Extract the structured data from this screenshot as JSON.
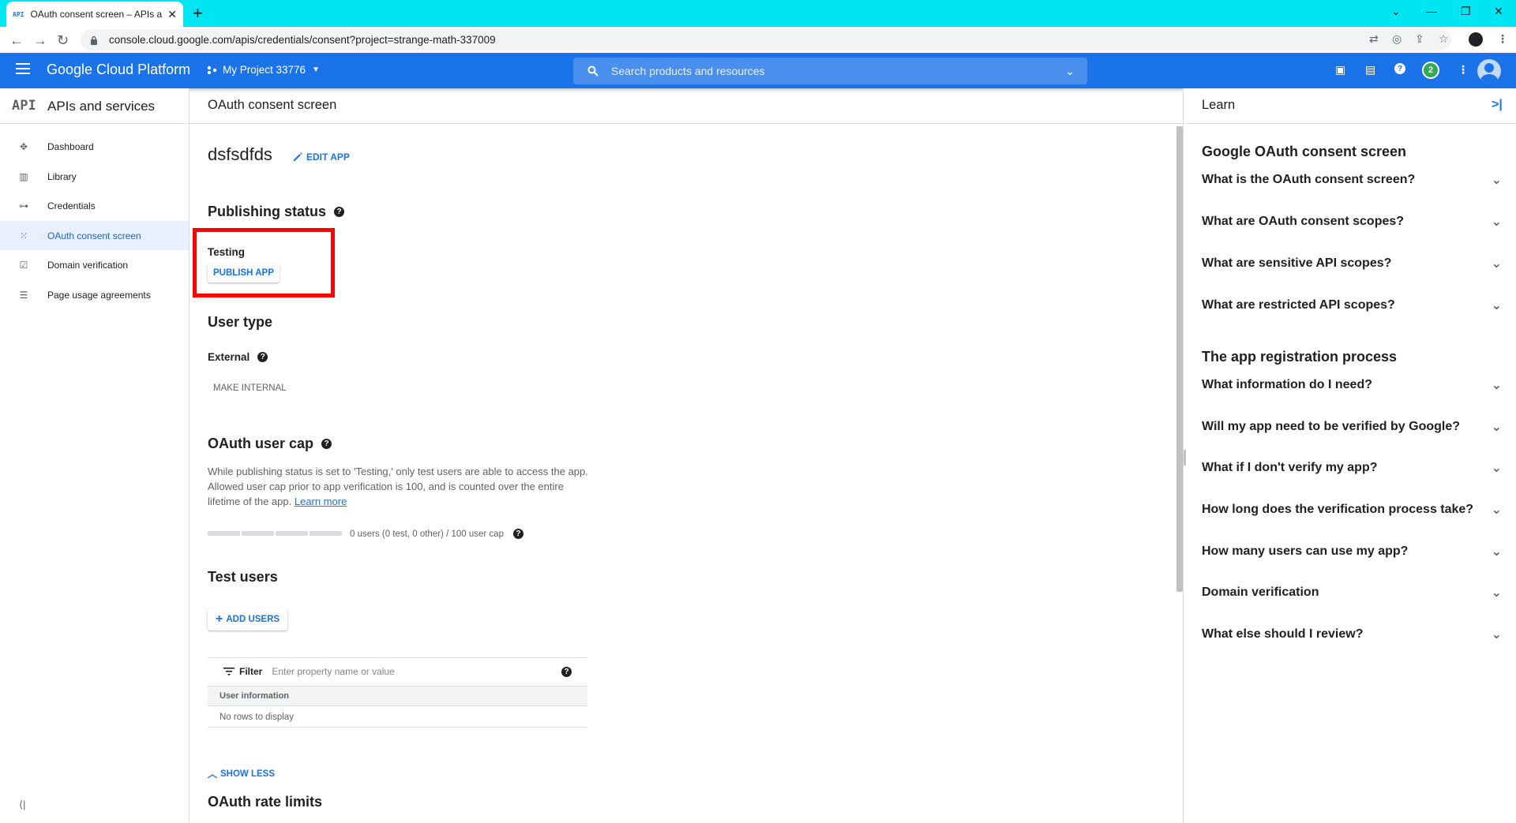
{
  "browser": {
    "tab_title": "OAuth consent screen – APIs and services",
    "tab_favicon": "API",
    "url": "console.cloud.google.com/apis/credentials/consent?project=strange-math-337009"
  },
  "header": {
    "brand": "Google Cloud Platform",
    "project": "My Project 33776",
    "search_placeholder": "Search products and resources",
    "notification_count": "2"
  },
  "sidebar": {
    "logo": "API",
    "title": "APIs and services",
    "items": [
      {
        "label": "Dashboard",
        "icon": "dashboard-icon"
      },
      {
        "label": "Library",
        "icon": "library-icon"
      },
      {
        "label": "Credentials",
        "icon": "key-icon"
      },
      {
        "label": "OAuth consent screen",
        "icon": "consent-icon",
        "active": true
      },
      {
        "label": "Domain verification",
        "icon": "checkbox-icon"
      },
      {
        "label": "Page usage agreements",
        "icon": "settings-list-icon"
      }
    ]
  },
  "main": {
    "page_title": "OAuth consent screen",
    "app_name": "dsfsdfds",
    "edit_app": "EDIT APP",
    "publishing_status": {
      "heading": "Publishing status",
      "status": "Testing",
      "publish_button": "PUBLISH APP"
    },
    "user_type": {
      "heading": "User type",
      "value": "External",
      "make_internal": "MAKE INTERNAL"
    },
    "user_cap": {
      "heading": "OAuth user cap",
      "description": "While publishing status is set to 'Testing,' only test users are able to access the app. Allowed user cap prior to app verification is 100, and is counted over the entire lifetime of the app.",
      "learn_more": "Learn more",
      "cap_text": "0 users (0 test, 0 other) / 100 user cap",
      "cap_fraction": 0
    },
    "test_users": {
      "heading": "Test users",
      "add_users": "ADD USERS",
      "filter_label": "Filter",
      "filter_placeholder": "Enter property name or value",
      "column_header": "User information",
      "empty_text": "No rows to display"
    },
    "show_less": "SHOW LESS",
    "rate_limits_heading": "OAuth rate limits"
  },
  "learn": {
    "title": "Learn",
    "section1": "Google OAuth consent screen",
    "section1_items": [
      "What is the OAuth consent screen?",
      "What are OAuth consent scopes?",
      "What are sensitive API scopes?",
      "What are restricted API scopes?"
    ],
    "section2": "The app registration process",
    "section2_items": [
      "What information do I need?",
      "Will my app need to be verified by Google?",
      "What if I don't verify my app?",
      "How long does the verification process take?",
      "How many users can use my app?",
      "Domain verification",
      "What else should I review?"
    ]
  },
  "colors": {
    "brand_blue": "#1a73e8",
    "tab_bar": "#00e5f2",
    "highlight": "#ff0000"
  }
}
